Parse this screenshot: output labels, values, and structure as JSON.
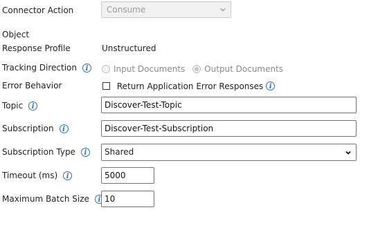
{
  "connector_action": {
    "label": "Connector Action",
    "value": "Consume"
  },
  "object": {
    "label": "Object"
  },
  "response_profile": {
    "label": "Response Profile",
    "value": "Unstructured"
  },
  "tracking_direction": {
    "label": "Tracking Direction",
    "option1": "Input Documents",
    "option2": "Output Documents"
  },
  "error_behavior": {
    "label": "Error Behavior",
    "checkbox_label": "Return Application Error Responses"
  },
  "topic": {
    "label": "Topic",
    "value": "Discover-Test-Topic"
  },
  "subscription": {
    "label": "Subscription",
    "value": "Discover-Test-Subscription"
  },
  "subscription_type": {
    "label": "Subscription Type",
    "value": "Shared"
  },
  "timeout": {
    "label": "Timeout (ms)",
    "value": "5000"
  },
  "max_batch": {
    "label": "Maximum Batch Size",
    "value": "10"
  },
  "info_glyph": "i",
  "colors": {
    "info": "#2d6fb3",
    "disabled_text": "#9a9a9a"
  }
}
